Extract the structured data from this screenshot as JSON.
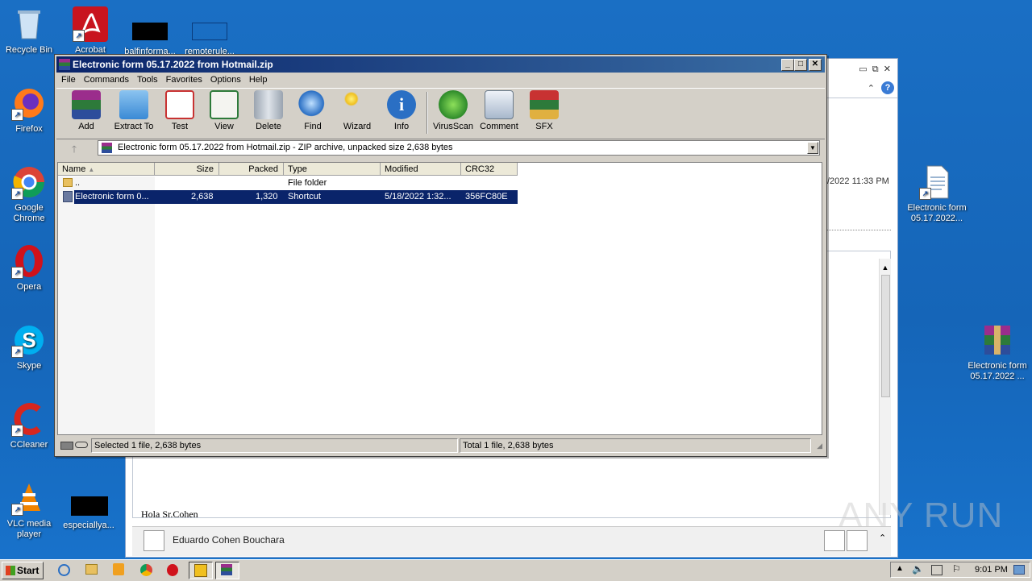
{
  "desktop": {
    "icons": [
      {
        "label": "Recycle Bin",
        "icon": "recycle-bin-icon"
      },
      {
        "label": "Acrobat",
        "icon": "acrobat-icon"
      },
      {
        "label": "balfinforma...",
        "icon": "file-icon"
      },
      {
        "label": "remoterule...",
        "icon": "file-icon"
      },
      {
        "label": "Firefox",
        "icon": "firefox-icon"
      },
      {
        "label": "Google Chrome",
        "icon": "chrome-icon"
      },
      {
        "label": "Opera",
        "icon": "opera-icon"
      },
      {
        "label": "Skype",
        "icon": "skype-icon"
      },
      {
        "label": "CCleaner",
        "icon": "ccleaner-icon"
      },
      {
        "label": "VLC media player",
        "icon": "vlc-icon"
      },
      {
        "label": "especiallya...",
        "icon": "file-icon"
      },
      {
        "label": "Electronic form 05.17.2022...",
        "icon": "document-icon"
      },
      {
        "label": "Electronic form 05.17.2022 ...",
        "icon": "winrar-archive-icon"
      }
    ]
  },
  "background_window": {
    "date_fragment": "/2022 11:33 PM",
    "greeting": "Hola Sr.Cohen",
    "sender": "Eduardo Cohen Bouchara"
  },
  "winrar": {
    "title": "Electronic form 05.17.2022 from Hotmail.zip",
    "menu": [
      "File",
      "Commands",
      "Tools",
      "Favorites",
      "Options",
      "Help"
    ],
    "toolbar": [
      "Add",
      "Extract To",
      "Test",
      "View",
      "Delete",
      "Find",
      "Wizard",
      "Info",
      "VirusScan",
      "Comment",
      "SFX"
    ],
    "path": "Electronic form 05.17.2022 from Hotmail.zip - ZIP archive, unpacked size 2,638 bytes",
    "columns": [
      "Name",
      "Size",
      "Packed",
      "Type",
      "Modified",
      "CRC32"
    ],
    "rows": [
      {
        "name": "..",
        "size": "",
        "packed": "",
        "type": "File folder",
        "modified": "",
        "crc": ""
      },
      {
        "name": "Electronic form 0...",
        "size": "2,638",
        "packed": "1,320",
        "type": "Shortcut",
        "modified": "5/18/2022 1:32...",
        "crc": "356FC80E"
      }
    ],
    "status_left": "Selected 1 file, 2,638 bytes",
    "status_right": "Total 1 file, 2,638 bytes"
  },
  "taskbar": {
    "start": "Start",
    "clock": "9:01 PM"
  },
  "watermark": "ANY RUN"
}
